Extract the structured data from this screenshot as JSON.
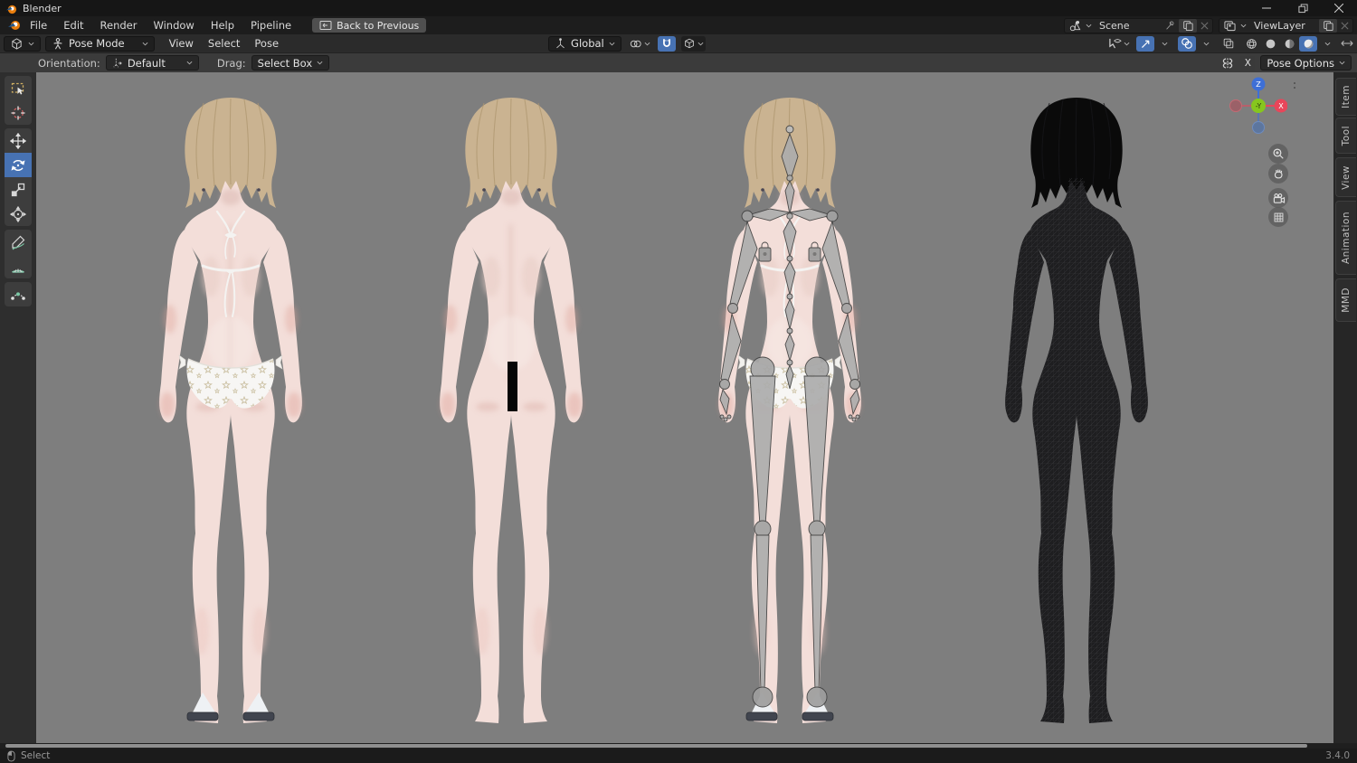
{
  "titlebar": {
    "app_name": "Blender"
  },
  "menubar": {
    "items": [
      "File",
      "Edit",
      "Render",
      "Window",
      "Help",
      "Pipeline"
    ],
    "back_button": "Back to Previous"
  },
  "scene_row": {
    "scene_name": "Scene",
    "viewlayer_name": "ViewLayer"
  },
  "viewport_header": {
    "mode": "Pose Mode",
    "menus": [
      "View",
      "Select",
      "Pose"
    ],
    "orientation": "Global"
  },
  "tool_settings": {
    "orientation_label": "Orientation:",
    "orientation_value": "Default",
    "drag_label": "Drag:",
    "drag_value": "Select Box",
    "mirror_x_label": "X",
    "pose_options_label": "Pose Options"
  },
  "toolbar": {
    "tools": [
      "box-select",
      "cursor",
      "move",
      "rotate",
      "scale",
      "transform",
      "annotate",
      "measure",
      "pose-breakdowner"
    ],
    "active_tool": "rotate"
  },
  "sidebar_tabs": {
    "items": [
      "Item",
      "Tool",
      "View",
      "Animation",
      "MMD"
    ]
  },
  "nav_gizmo": {
    "z_label": "Z",
    "x_label": "X",
    "y_label": "-Y"
  },
  "viewport": {
    "figures": [
      "textured bikini model",
      "textured censored model",
      "armature overlay model",
      "wireframe model"
    ]
  },
  "statusbar": {
    "action_label": "Select",
    "version": "3.4.0"
  },
  "colors": {
    "accent_blue": "#4772b3",
    "viewport_bg": "#7e7e7e",
    "skin": "#f3ded9",
    "hair": "#cab391",
    "bone": "#ababab",
    "axis_x": "#e8465a",
    "axis_y": "#86c61e",
    "axis_z": "#3e6fd6"
  }
}
